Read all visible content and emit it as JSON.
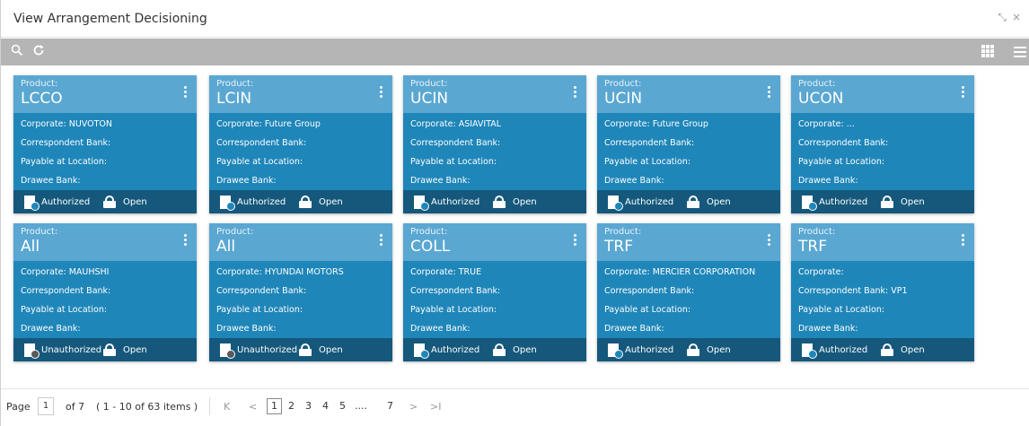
{
  "window": {
    "title": "View Arrangement Decisioning"
  },
  "toolbar": {
    "search_icon": "search-icon",
    "refresh_icon": "refresh-icon",
    "grid_icon": "grid-view-icon",
    "list_icon": "list-view-icon"
  },
  "card_labels": {
    "product": "Product:",
    "corporate": "Corporate:",
    "correspondent_bank": "Correspondent Bank:",
    "payable_at_location": "Payable at Location:",
    "drawee_bank": "Drawee Bank:",
    "open": "Open"
  },
  "cards": [
    {
      "product": "LCCO",
      "corporate": "Corporate:  NUVOTON",
      "correspondent_bank": "Correspondent Bank:",
      "status": "Authorized"
    },
    {
      "product": "LCIN",
      "corporate": "Corporate:  Future Group",
      "correspondent_bank": "Correspondent Bank:",
      "status": "Authorized"
    },
    {
      "product": "UCIN",
      "corporate": "Corporate:  ASIAVITAL",
      "correspondent_bank": "Correspondent Bank:",
      "status": "Authorized"
    },
    {
      "product": "UCIN",
      "corporate": "Corporate:  Future Group",
      "correspondent_bank": "Correspondent Bank:",
      "status": "Authorized"
    },
    {
      "product": "UCON",
      "corporate": "Corporate:  ...",
      "correspondent_bank": "Correspondent Bank:",
      "status": "Authorized"
    },
    {
      "product": "All",
      "corporate": "Corporate:  MAUHSHI",
      "correspondent_bank": "Correspondent Bank:",
      "status": "Unauthorized"
    },
    {
      "product": "All",
      "corporate": "Corporate:  HYUNDAI MOTORS",
      "correspondent_bank": "Correspondent Bank:",
      "status": "Unauthorized"
    },
    {
      "product": "COLL",
      "corporate": "Corporate:  TRUE",
      "correspondent_bank": "Correspondent Bank:",
      "status": "Authorized"
    },
    {
      "product": "TRF",
      "corporate": "Corporate:  MERCIER CORPORATION",
      "correspondent_bank": "Correspondent Bank:",
      "status": "Authorized"
    },
    {
      "product": "TRF",
      "corporate": "Corporate:",
      "correspondent_bank": "Correspondent Bank:  VP1",
      "status": "Authorized"
    }
  ],
  "pagination": {
    "page_label": "Page",
    "current_page": "1",
    "of_pages": "of 7",
    "items_info": "( 1 - 10 of 63 items )",
    "first": "K",
    "prev": "<",
    "next": ">",
    "last": ">I",
    "pages": [
      "1",
      "2",
      "3",
      "4",
      "5",
      "....",
      "7"
    ]
  },
  "colors": {
    "card_body": "#1f86b9",
    "card_header": "#5aa7d2",
    "card_footer": "#15587c",
    "toolbar": "#b5b5b5"
  }
}
